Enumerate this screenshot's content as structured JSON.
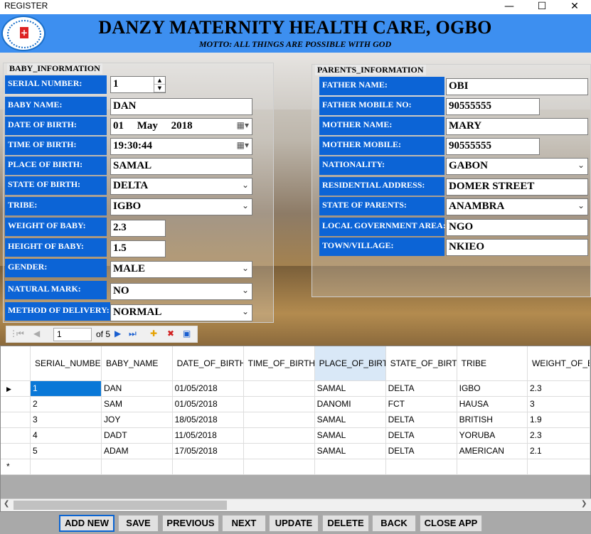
{
  "window": {
    "title": "REGISTER"
  },
  "header": {
    "title": "DANZY MATERNITY HEALTH CARE, OGBO",
    "motto": "MOTTO: ALL THINGS ARE POSSIBLE WITH GOD"
  },
  "baby": {
    "title": "BABY_INFORMATION",
    "serial_label": "SERIAL NUMBER:",
    "serial_value": "1",
    "name_label": "BABY NAME:",
    "name_value": "DAN",
    "dob_label": "DATE OF BIRTH:",
    "dob_day": "01",
    "dob_month": "May",
    "dob_year": "2018",
    "tob_label": "TIME OF BIRTH:",
    "tob_value": "19:30:44",
    "pob_label": "PLACE OF BIRTH:",
    "pob_value": "SAMAL",
    "sob_label": "STATE OF BIRTH:",
    "sob_value": "DELTA",
    "tribe_label": "TRIBE:",
    "tribe_value": "IGBO",
    "weight_label": "WEIGHT OF BABY:",
    "weight_value": "2.3",
    "height_label": "HEIGHT OF BABY:",
    "height_value": "1.5",
    "gender_label": "GENDER:",
    "gender_value": "MALE",
    "mark_label": "NATURAL MARK:",
    "mark_value": "NO",
    "delivery_label": "METHOD OF DELIVERY:",
    "delivery_value": "NORMAL"
  },
  "parents": {
    "title": "PARENTS_INFORMATION",
    "father_label": "FATHER NAME:",
    "father_value": "OBI",
    "fmobile_label": "FATHER MOBILE NO:",
    "fmobile_value": "90555555",
    "mother_label": "MOTHER NAME:",
    "mother_value": "MARY",
    "mmobile_label": "MOTHER MOBILE:",
    "mmobile_value": "90555555",
    "nationality_label": "NATIONALITY:",
    "nationality_value": "GABON",
    "address_label": "RESIDENTIAL ADDRESS:",
    "address_value": "DOMER STREET",
    "state_label": "STATE OF PARENTS:",
    "state_value": "ANAMBRA",
    "lga_label": "LOCAL GOVERNMENT AREA:",
    "lga_value": "NGO",
    "town_label": "TOWN/VILLAGE:",
    "town_value": "NKIEO"
  },
  "navigator": {
    "position": "1",
    "of_label": "of 5"
  },
  "grid": {
    "columns": [
      "SERIAL_NUMBER",
      "BABY_NAME",
      "DATE_OF_BIRTH",
      "TIME_OF_BIRTH",
      "PLACE_OF_BIRTH",
      "STATE_OF_BIRTH",
      "TRIBE",
      "WEIGHT_OF_B"
    ],
    "rows": [
      [
        "1",
        "DAN",
        "01/05/2018",
        "",
        "SAMAL",
        "DELTA",
        "IGBO",
        "2.3"
      ],
      [
        "2",
        "SAM",
        "01/05/2018",
        "",
        "DANOMI",
        "FCT",
        "HAUSA",
        "3"
      ],
      [
        "3",
        "JOY",
        "18/05/2018",
        "",
        "SAMAL",
        "DELTA",
        "BRITISH",
        "1.9"
      ],
      [
        "4",
        "DADT",
        "11/05/2018",
        "",
        "SAMAL",
        "DELTA",
        "YORUBA",
        "2.3"
      ],
      [
        "5",
        "ADAM",
        "17/05/2018",
        "",
        "SAMAL",
        "DELTA",
        "AMERICAN",
        "2.1"
      ]
    ],
    "new_row_marker": "*"
  },
  "buttons": {
    "add_new": "ADD NEW",
    "save": "SAVE",
    "previous": "PREVIOUS",
    "next": "NEXT",
    "update": "UPDATE",
    "delete": "DELETE",
    "back": "BACK",
    "close_app": "CLOSE APP"
  },
  "colors": {
    "header_bg": "#3d8ff0",
    "label_bg": "#0c64d6",
    "grid_selected": "#0a78d7"
  }
}
